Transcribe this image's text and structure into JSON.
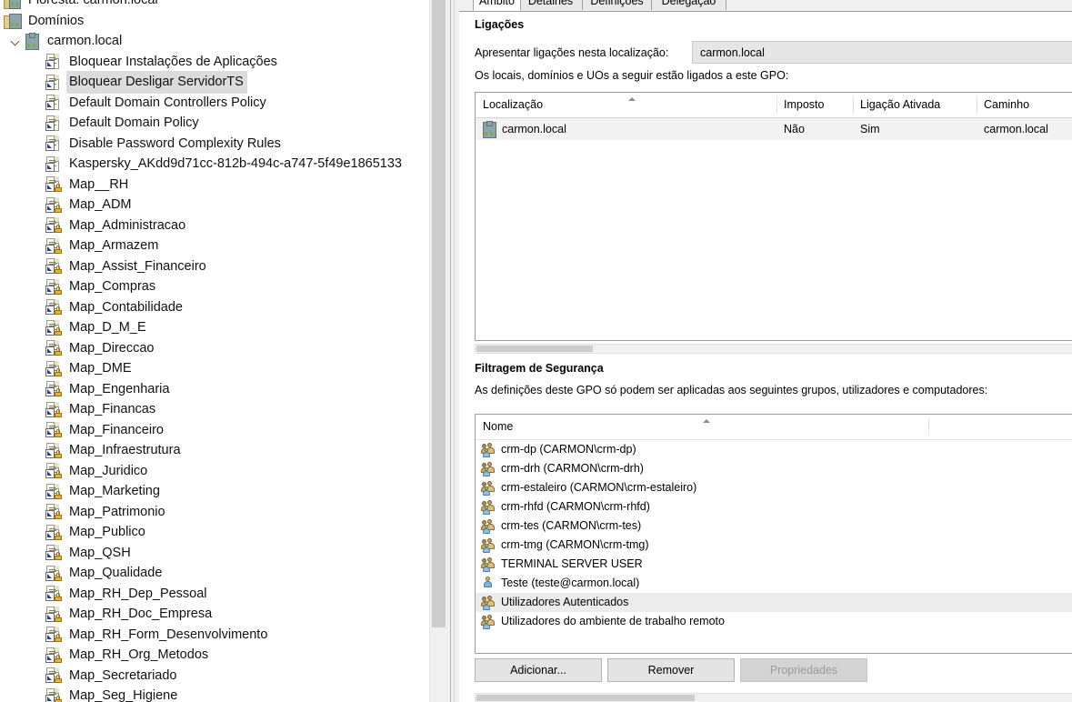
{
  "tree": {
    "root_partial": "Floresta: carmon.local",
    "items": [
      {
        "label": "Floresta: carmon.local",
        "icon": "forest-icon",
        "indent": 0,
        "type": "forest",
        "clipped": true
      },
      {
        "label": "Domínios",
        "icon": "domain-folder-icon",
        "indent": 1,
        "type": "domains"
      },
      {
        "label": "carmon.local",
        "icon": "domain-icon",
        "indent": 2,
        "type": "domain",
        "expanded": true
      },
      {
        "label": "Bloquear Instalações de Aplicações",
        "icon": "gpo-icon",
        "indent": 3,
        "type": "gpo"
      },
      {
        "label": "Bloquear Desligar ServidorTS",
        "icon": "gpo-icon",
        "indent": 3,
        "type": "gpo",
        "selected": true
      },
      {
        "label": "Default Domain Controllers Policy",
        "icon": "gpo-icon",
        "indent": 3,
        "type": "gpo"
      },
      {
        "label": "Default Domain Policy",
        "icon": "gpo-icon",
        "indent": 3,
        "type": "gpo"
      },
      {
        "label": "Disable Password Complexity Rules",
        "icon": "gpo-icon",
        "indent": 3,
        "type": "gpo"
      },
      {
        "label": "Kaspersky_AKdd9d71cc-812b-494c-a747-5f49e1865133",
        "icon": "gpo-icon",
        "indent": 3,
        "type": "gpo"
      },
      {
        "label": "Map__RH",
        "icon": "gpo-locked-icon",
        "indent": 3,
        "type": "gpo-locked"
      },
      {
        "label": "Map_ADM",
        "icon": "gpo-locked-icon",
        "indent": 3,
        "type": "gpo-locked"
      },
      {
        "label": "Map_Administracao",
        "icon": "gpo-locked-icon",
        "indent": 3,
        "type": "gpo-locked"
      },
      {
        "label": "Map_Armazem",
        "icon": "gpo-locked-icon",
        "indent": 3,
        "type": "gpo-locked"
      },
      {
        "label": "Map_Assist_Financeiro",
        "icon": "gpo-locked-icon",
        "indent": 3,
        "type": "gpo-locked"
      },
      {
        "label": "Map_Compras",
        "icon": "gpo-locked-icon",
        "indent": 3,
        "type": "gpo-locked"
      },
      {
        "label": "Map_Contabilidade",
        "icon": "gpo-locked-icon",
        "indent": 3,
        "type": "gpo-locked"
      },
      {
        "label": "Map_D_M_E",
        "icon": "gpo-locked-icon",
        "indent": 3,
        "type": "gpo-locked"
      },
      {
        "label": "Map_Direccao",
        "icon": "gpo-locked-icon",
        "indent": 3,
        "type": "gpo-locked"
      },
      {
        "label": "Map_DME",
        "icon": "gpo-locked-icon",
        "indent": 3,
        "type": "gpo-locked"
      },
      {
        "label": "Map_Engenharia",
        "icon": "gpo-locked-icon",
        "indent": 3,
        "type": "gpo-locked"
      },
      {
        "label": "Map_Financas",
        "icon": "gpo-locked-icon",
        "indent": 3,
        "type": "gpo-locked"
      },
      {
        "label": "Map_Financeiro",
        "icon": "gpo-locked-icon",
        "indent": 3,
        "type": "gpo-locked"
      },
      {
        "label": "Map_Infraestrutura",
        "icon": "gpo-locked-icon",
        "indent": 3,
        "type": "gpo-locked"
      },
      {
        "label": "Map_Juridico",
        "icon": "gpo-locked-icon",
        "indent": 3,
        "type": "gpo-locked"
      },
      {
        "label": "Map_Marketing",
        "icon": "gpo-locked-icon",
        "indent": 3,
        "type": "gpo-locked"
      },
      {
        "label": "Map_Patrimonio",
        "icon": "gpo-locked-icon",
        "indent": 3,
        "type": "gpo-locked"
      },
      {
        "label": "Map_Publico",
        "icon": "gpo-locked-icon",
        "indent": 3,
        "type": "gpo-locked"
      },
      {
        "label": "Map_QSH",
        "icon": "gpo-locked-icon",
        "indent": 3,
        "type": "gpo-locked"
      },
      {
        "label": "Map_Qualidade",
        "icon": "gpo-locked-icon",
        "indent": 3,
        "type": "gpo-locked"
      },
      {
        "label": "Map_RH_Dep_Pessoal",
        "icon": "gpo-locked-icon",
        "indent": 3,
        "type": "gpo-locked"
      },
      {
        "label": "Map_RH_Doc_Empresa",
        "icon": "gpo-locked-icon",
        "indent": 3,
        "type": "gpo-locked"
      },
      {
        "label": "Map_RH_Form_Desenvolvimento",
        "icon": "gpo-locked-icon",
        "indent": 3,
        "type": "gpo-locked"
      },
      {
        "label": "Map_RH_Org_Metodos",
        "icon": "gpo-locked-icon",
        "indent": 3,
        "type": "gpo-locked"
      },
      {
        "label": "Map_Secretariado",
        "icon": "gpo-locked-icon",
        "indent": 3,
        "type": "gpo-locked"
      },
      {
        "label": "Map_Seg_Higiene",
        "icon": "gpo-locked-icon",
        "indent": 3,
        "type": "gpo-locked"
      }
    ]
  },
  "tabs": [
    {
      "label": "Âmbito",
      "active": true
    },
    {
      "label": "Detalhes",
      "active": false
    },
    {
      "label": "Definições",
      "active": false
    },
    {
      "label": "Delegação",
      "active": false
    }
  ],
  "links": {
    "title": "Ligações",
    "location_label": "Apresentar ligações nesta localização:",
    "location_value": "carmon.local",
    "list_caption": "Os locais, domínios e UOs a seguir estão ligados a este GPO:",
    "columns": [
      "Localização",
      "Imposto",
      "Ligação Ativada",
      "Caminho"
    ],
    "rows": [
      {
        "localizacao": "carmon.local",
        "imposto": "Não",
        "ligacao_ativada": "Sim",
        "caminho": "carmon.local",
        "icon": "domain-icon"
      }
    ]
  },
  "security": {
    "title": "Filtragem de Segurança",
    "caption": "As definições deste GPO só podem ser aplicadas aos seguintes grupos, utilizadores e computadores:",
    "column": "Nome",
    "entries": [
      {
        "name": "crm-dp (CARMON\\crm-dp)",
        "icon": "group-icon",
        "selected": false
      },
      {
        "name": "crm-drh (CARMON\\crm-drh)",
        "icon": "group-icon",
        "selected": false
      },
      {
        "name": "crm-estaleiro (CARMON\\crm-estaleiro)",
        "icon": "group-icon",
        "selected": false
      },
      {
        "name": "crm-rhfd (CARMON\\crm-rhfd)",
        "icon": "group-icon",
        "selected": false
      },
      {
        "name": "crm-tes (CARMON\\crm-tes)",
        "icon": "group-icon",
        "selected": false
      },
      {
        "name": "crm-tmg (CARMON\\crm-tmg)",
        "icon": "group-icon",
        "selected": false
      },
      {
        "name": "TERMINAL SERVER USER",
        "icon": "group-icon",
        "selected": false
      },
      {
        "name": "Teste (teste@carmon.local)",
        "icon": "user-icon",
        "selected": false
      },
      {
        "name": "Utilizadores Autenticados",
        "icon": "group-icon",
        "selected": true
      },
      {
        "name": "Utilizadores do ambiente de trabalho remoto",
        "icon": "group-icon",
        "selected": false
      }
    ],
    "buttons": [
      {
        "label": "Adicionar...",
        "disabled": false
      },
      {
        "label": "Remover",
        "disabled": false
      },
      {
        "label": "Propriedades",
        "disabled": true
      }
    ]
  },
  "colors": {
    "selection": "#dcdcdc",
    "row_alt": "#f3f3f3",
    "list_selection": "#ececec",
    "border": "#9d9d9d"
  }
}
